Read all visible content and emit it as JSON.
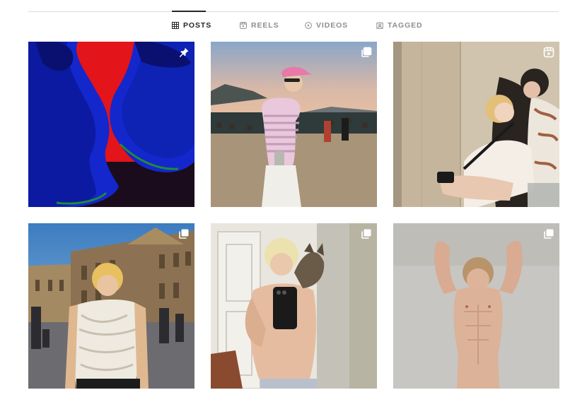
{
  "profile_tabs": {
    "active": "posts",
    "items": [
      {
        "key": "posts",
        "label": "POSTS",
        "icon": "grid-icon"
      },
      {
        "key": "reels",
        "label": "REELS",
        "icon": "reels-icon"
      },
      {
        "key": "videos",
        "label": "VIDEOS",
        "icon": "play-circle-icon"
      },
      {
        "key": "tagged",
        "label": "TAGGED",
        "icon": "tagged-icon"
      }
    ]
  },
  "posts": [
    {
      "type": "pinned",
      "badge_icon": "pin-icon",
      "description": "two faces in blue light on red background"
    },
    {
      "type": "carousel",
      "badge_icon": "carousel-icon",
      "description": "person in pink cap and striped polo at festival"
    },
    {
      "type": "reel",
      "badge_icon": "reels-icon",
      "description": "two people with a camera by stone wall"
    },
    {
      "type": "carousel",
      "badge_icon": "carousel-icon",
      "description": "person in lace top in front of palace"
    },
    {
      "type": "carousel",
      "badge_icon": "carousel-icon",
      "description": "mirror selfie with cat on shoulder"
    },
    {
      "type": "carousel",
      "badge_icon": "carousel-icon",
      "description": "shirtless person with arms raised"
    }
  ],
  "colors": {
    "active_tab": "#262626",
    "inactive_tab": "#8e8e8e",
    "divider": "#dbdbdb"
  }
}
